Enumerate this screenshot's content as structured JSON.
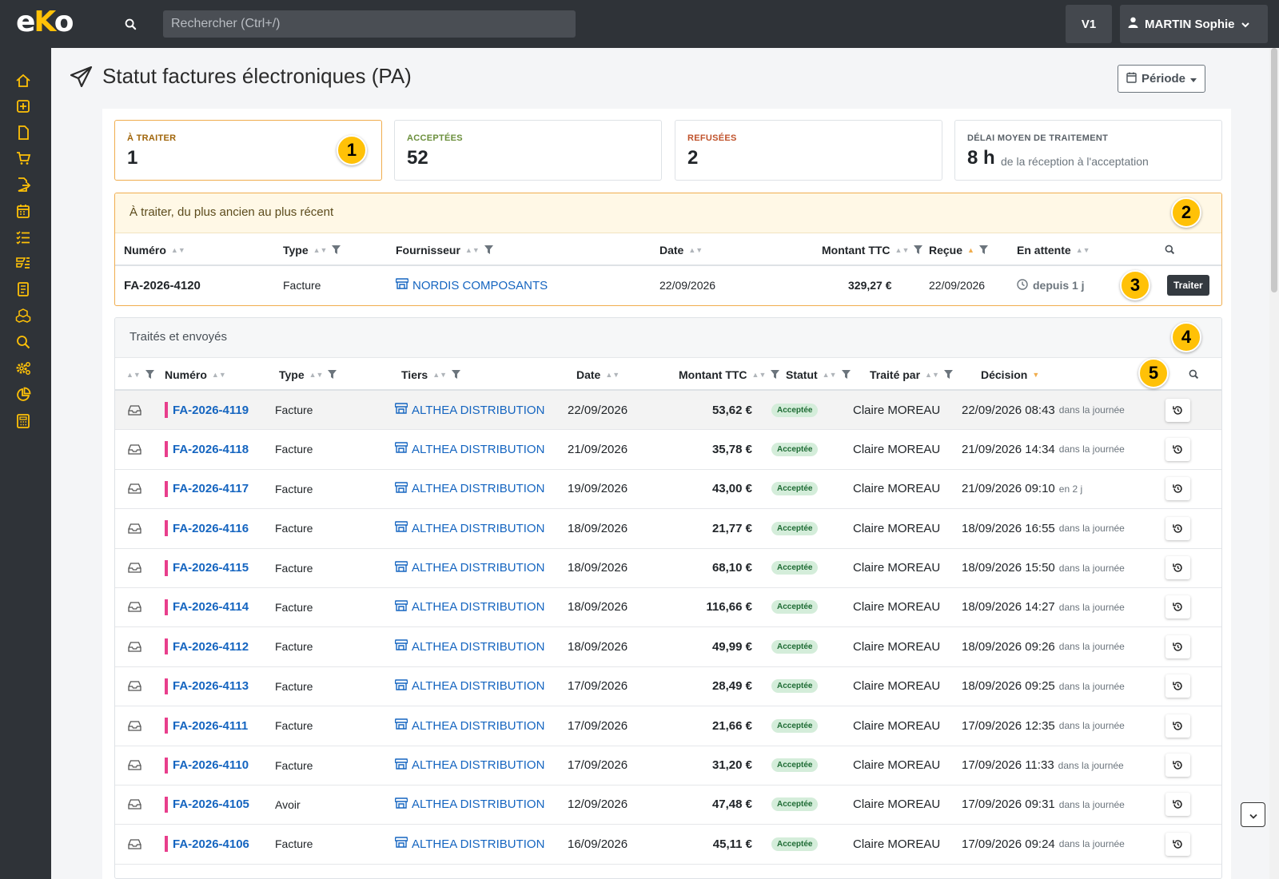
{
  "app": {
    "logo_text_1": "e",
    "logo_text_2": "K",
    "logo_text_3": "o"
  },
  "search": {
    "placeholder": "Rechercher (Ctrl+/)"
  },
  "topbar": {
    "version": "V1",
    "user": "MARTIN Sophie"
  },
  "colors": {
    "accent": "#ffc107",
    "sidebar": "#2f3338",
    "link": "#1565c0",
    "flag": "#e83e8c"
  },
  "sidebar": {
    "icons": [
      "home-icon",
      "plus-square-icon",
      "file-icon",
      "cart-icon",
      "file-export-icon",
      "calendar-icon",
      "checklist-icon",
      "tasks-icon",
      "document-list-icon",
      "boxes-icon",
      "search-icon",
      "settings-icon",
      "pie-chart-icon",
      "calculator-icon"
    ]
  },
  "page": {
    "title": "Statut factures électroniques (PA)",
    "periode": "Période"
  },
  "kpis": [
    {
      "label": "À TRAITER",
      "value": "1",
      "color": "#a0650a"
    },
    {
      "label": "ACCEPTÉES",
      "value": "52",
      "color": "#6b8f3c"
    },
    {
      "label": "REFUSÉES",
      "value": "2",
      "color": "#c0522b"
    },
    {
      "label": "DÉLAI MOYEN DE TRAITEMENT",
      "value": "8 h",
      "sub": "de la réception à l'acceptation",
      "color": "#5a6168"
    }
  ],
  "badges": [
    "1",
    "2",
    "3",
    "4",
    "5"
  ],
  "pending": {
    "title": "À traiter, du plus ancien au plus récent",
    "columns": [
      "Numéro",
      "Type",
      "Fournisseur",
      "Date",
      "Montant TTC",
      "Reçue",
      "En attente"
    ],
    "row": {
      "numero": "FA-2026-4120",
      "type": "Facture",
      "fournisseur": "NORDIS COMPOSANTS",
      "date": "22/09/2026",
      "montant": "329,27 €",
      "recue": "22/09/2026",
      "attente": "depuis 1 j",
      "action": "Traiter"
    }
  },
  "processed": {
    "title": "Traités et envoyés",
    "columns": [
      "Numéro",
      "Type",
      "Tiers",
      "Date",
      "Montant TTC",
      "Statut",
      "Traité par",
      "Décision"
    ],
    "rows": [
      {
        "numero": "FA-2026-4119",
        "type": "Facture",
        "tiers": "ALTHEA DISTRIBUTION",
        "date": "22/09/2026",
        "montant": "53,62 €",
        "statut": "Acceptée",
        "par": "Claire MOREAU",
        "decision": "22/09/2026 08:43",
        "note": "dans la journée"
      },
      {
        "numero": "FA-2026-4118",
        "type": "Facture",
        "tiers": "ALTHEA DISTRIBUTION",
        "date": "21/09/2026",
        "montant": "35,78 €",
        "statut": "Acceptée",
        "par": "Claire MOREAU",
        "decision": "21/09/2026 14:34",
        "note": "dans la journée"
      },
      {
        "numero": "FA-2026-4117",
        "type": "Facture",
        "tiers": "ALTHEA DISTRIBUTION",
        "date": "19/09/2026",
        "montant": "43,00 €",
        "statut": "Acceptée",
        "par": "Claire MOREAU",
        "decision": "21/09/2026 09:10",
        "note": "en 2 j"
      },
      {
        "numero": "FA-2026-4116",
        "type": "Facture",
        "tiers": "ALTHEA DISTRIBUTION",
        "date": "18/09/2026",
        "montant": "21,77 €",
        "statut": "Acceptée",
        "par": "Claire MOREAU",
        "decision": "18/09/2026 16:55",
        "note": "dans la journée"
      },
      {
        "numero": "FA-2026-4115",
        "type": "Facture",
        "tiers": "ALTHEA DISTRIBUTION",
        "date": "18/09/2026",
        "montant": "68,10 €",
        "statut": "Acceptée",
        "par": "Claire MOREAU",
        "decision": "18/09/2026 15:50",
        "note": "dans la journée"
      },
      {
        "numero": "FA-2026-4114",
        "type": "Facture",
        "tiers": "ALTHEA DISTRIBUTION",
        "date": "18/09/2026",
        "montant": "116,66 €",
        "statut": "Acceptée",
        "par": "Claire MOREAU",
        "decision": "18/09/2026 14:27",
        "note": "dans la journée"
      },
      {
        "numero": "FA-2026-4112",
        "type": "Facture",
        "tiers": "ALTHEA DISTRIBUTION",
        "date": "18/09/2026",
        "montant": "49,99 €",
        "statut": "Acceptée",
        "par": "Claire MOREAU",
        "decision": "18/09/2026 09:26",
        "note": "dans la journée"
      },
      {
        "numero": "FA-2026-4113",
        "type": "Facture",
        "tiers": "ALTHEA DISTRIBUTION",
        "date": "17/09/2026",
        "montant": "28,49 €",
        "statut": "Acceptée",
        "par": "Claire MOREAU",
        "decision": "18/09/2026 09:25",
        "note": "dans la journée"
      },
      {
        "numero": "FA-2026-4111",
        "type": "Facture",
        "tiers": "ALTHEA DISTRIBUTION",
        "date": "17/09/2026",
        "montant": "21,66 €",
        "statut": "Acceptée",
        "par": "Claire MOREAU",
        "decision": "17/09/2026 12:35",
        "note": "dans la journée"
      },
      {
        "numero": "FA-2026-4110",
        "type": "Facture",
        "tiers": "ALTHEA DISTRIBUTION",
        "date": "17/09/2026",
        "montant": "31,20 €",
        "statut": "Acceptée",
        "par": "Claire MOREAU",
        "decision": "17/09/2026 11:33",
        "note": "dans la journée"
      },
      {
        "numero": "FA-2026-4105",
        "type": "Avoir",
        "tiers": "ALTHEA DISTRIBUTION",
        "date": "12/09/2026",
        "montant": "47,48 €",
        "statut": "Acceptée",
        "par": "Claire MOREAU",
        "decision": "17/09/2026 09:31",
        "note": "dans la journée"
      },
      {
        "numero": "FA-2026-4106",
        "type": "Facture",
        "tiers": "ALTHEA DISTRIBUTION",
        "date": "16/09/2026",
        "montant": "45,11 €",
        "statut": "Acceptée",
        "par": "Claire MOREAU",
        "decision": "17/09/2026 09:24",
        "note": "dans la journée"
      }
    ]
  }
}
